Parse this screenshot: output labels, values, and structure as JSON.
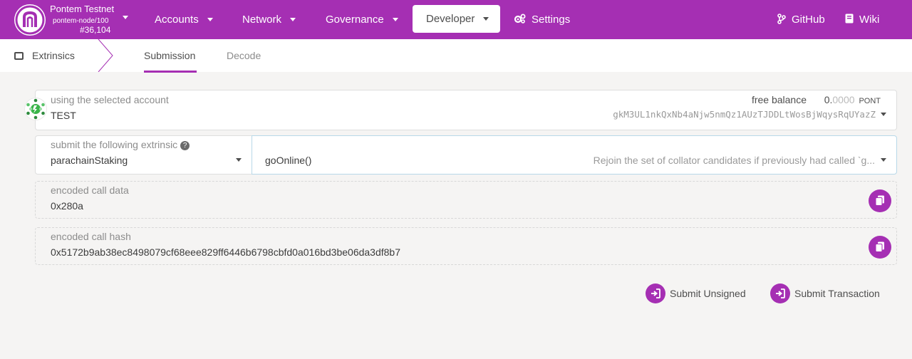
{
  "nav": {
    "chain_name": "Pontem Testnet",
    "node_name": "pontem-node/100",
    "block_number": "#36,104",
    "items": [
      {
        "label": "Accounts"
      },
      {
        "label": "Network"
      },
      {
        "label": "Governance"
      },
      {
        "label": "Developer"
      },
      {
        "label": "Settings"
      }
    ],
    "github": "GitHub",
    "wiki": "Wiki"
  },
  "subnav": {
    "section": "Extrinsics",
    "tabs": [
      {
        "label": "Submission",
        "active": true
      },
      {
        "label": "Decode",
        "active": false
      }
    ]
  },
  "account": {
    "label": "using the selected account",
    "name": "TEST",
    "free_balance_label": "free balance",
    "free_balance_int": "0.",
    "free_balance_dec": "0000",
    "free_balance_unit": "PONT",
    "address": "gkM3UL1nkQxNb4aNjw5nmQz1AUzTJDDLtWosBjWqysRqUYazZ"
  },
  "extrinsic": {
    "label": "submit the following extrinsic",
    "help_icon": "question-circle-icon",
    "pallet": "parachainStaking",
    "method": "goOnline()",
    "description": "Rejoin the set of collator candidates if previously had called `g..."
  },
  "encoded_call_data": {
    "label": "encoded call data",
    "value": "0x280a"
  },
  "encoded_call_hash": {
    "label": "encoded call hash",
    "value": "0x5172b9ab38ec8498079cf68eee829ff6446b6798cbfd0a016bd3be06da3df8b7"
  },
  "actions": {
    "submit_unsigned": "Submit Unsigned",
    "submit_transaction": "Submit Transaction"
  },
  "colors": {
    "accent": "#a52fb3",
    "background": "#f5f4f3"
  }
}
